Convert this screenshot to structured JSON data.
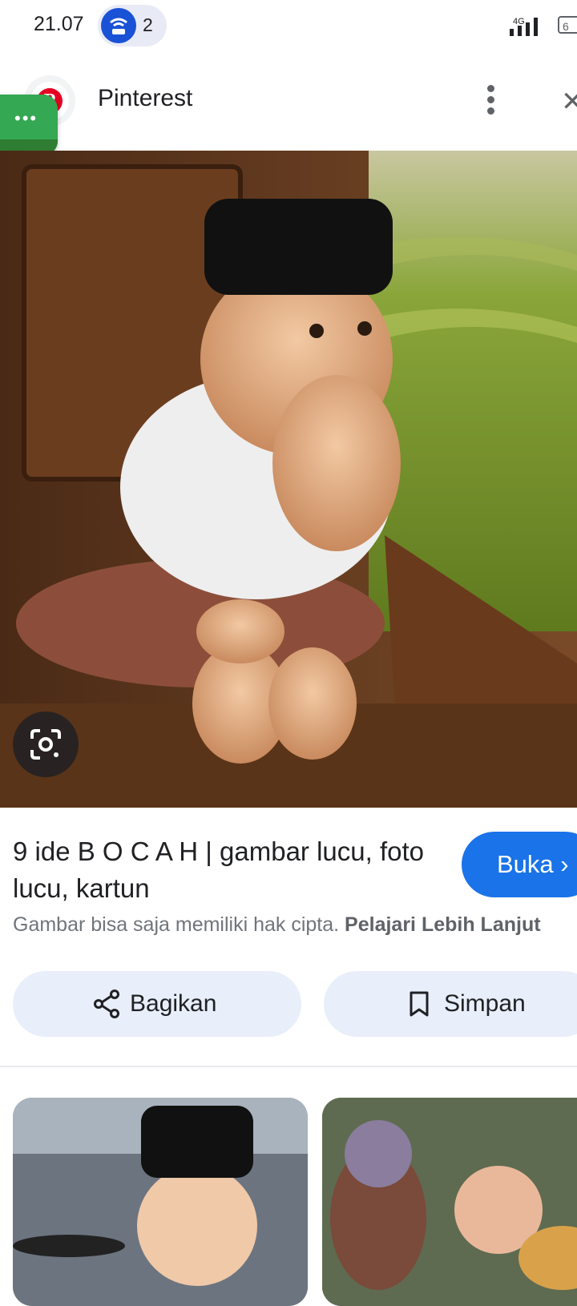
{
  "status_bar": {
    "time": "21.07",
    "hotspot_devices": "2",
    "network_type": "4G",
    "battery": "6"
  },
  "header": {
    "source_name": "Pinterest"
  },
  "result": {
    "title": "9 ide B O C A H | gambar lucu, foto lucu, kartun",
    "open_label": "Buka",
    "copyright_text": "Gambar bisa saja memiliki hak cipta.",
    "learn_more": "Pelajari Lebih Lanjut"
  },
  "actions": {
    "share_label": "Bagikan",
    "save_label": "Simpan"
  },
  "colors": {
    "accent_blue": "#1a73e8",
    "action_bg": "#e8eefa",
    "pinterest_red": "#e60023"
  }
}
